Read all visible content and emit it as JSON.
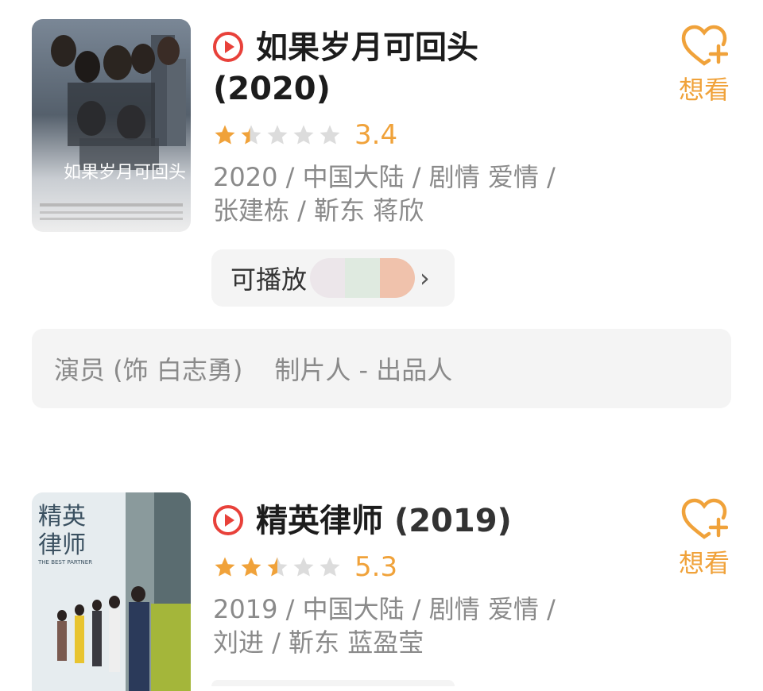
{
  "items": [
    {
      "title": "如果岁月可回头",
      "year": "(2020)",
      "rating": 3.4,
      "rating_text": "3.4",
      "meta_line1": "2020 / 中国大陆 / 剧情 爱情 /",
      "meta_line2": "张建栋 / 靳东 蒋欣",
      "want_label": "想看",
      "playable_label": "可播放",
      "role": "演员 (饰 白志勇)",
      "role2": "制片人 - 出品人",
      "poster_text": "如果岁月可回头"
    },
    {
      "title": "精英律师",
      "year": "(2019)",
      "rating": 5.3,
      "rating_text": "5.3",
      "meta_line1": "2019 / 中国大陆 / 剧情 爱情 /",
      "meta_line2": "刘进 / 靳东 蓝盈莹",
      "want_label": "想看",
      "poster_text_1": "精英",
      "poster_text_2": "律师",
      "poster_sub": "THE BEST PARTNER"
    }
  ],
  "colors": {
    "accent_orange": "#f0a23a",
    "play_red": "#e8413a",
    "meta_gray": "#8a8a8a",
    "box_bg": "#f4f4f4"
  },
  "icons": [
    "play-circle-icon",
    "star-icon",
    "heart-plus-icon",
    "chevron-right-icon"
  ]
}
